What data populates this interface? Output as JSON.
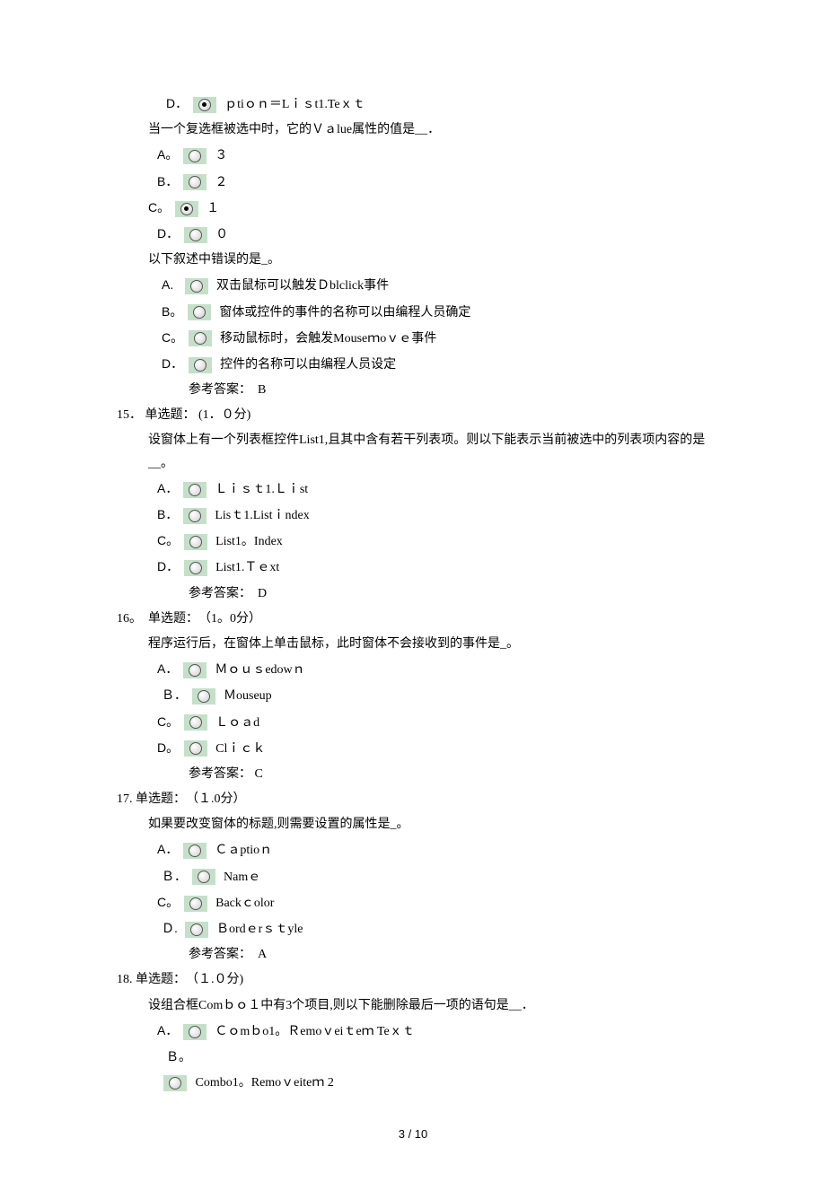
{
  "frag_d_label": "D．",
  "frag_d_text": "ｐtiｏｎ＝Lｉｓt1.Teｘｔ",
  "q13": {
    "stem": "当一个复选框被选中时，它的Ｖａlue属性的值是__．",
    "a_label": "A。",
    "a_text": "３",
    "b_label": "B．",
    "b_text": "２",
    "c_label": "C。",
    "c_text": "１",
    "d_label": "D．",
    "d_text": "０"
  },
  "q14": {
    "stem": "以下叙述中错误的是_。",
    "a_label": "A.",
    "a_text": "双击鼠标可以触发Ｄblclick事件",
    "b_label": "B。",
    "b_text": "窗体或控件的事件的名称可以由编程人员确定",
    "c_label": "C。",
    "c_text": "移动鼠标时，会触发Mouseｍoｖｅ事件",
    "d_label": "D．",
    "d_text": "控件的名称可以由编程人员设定",
    "ans": "参考答案：　B"
  },
  "q15": {
    "num": "15．  单选题：  (1．０分)",
    "stem": "设窗体上有一个列表框控件List1,且其中含有若干列表项。则以下能表示当前被选中的列表项内容的是__。",
    "a_label": "A．",
    "a_text": "Ｌｉｓｔ1.Ｌｉst",
    "b_label": "B．",
    "b_text": "Lisｔ1.Listｉndex",
    "c_label": "C。",
    "c_text": "List1。Index",
    "d_label": "D．",
    "d_text": "List1.Ｔｅxt",
    "ans": "参考答案：　D"
  },
  "q16": {
    "num": "16。　单选题：　（1。0分）",
    "stem": "程序运行后，在窗体上单击鼠标，此时窗体不会接收到的事件是_。",
    "a_label": "A．",
    "a_text": "Ｍｏｕｓedowｎ",
    "b_label": "Ｂ．",
    "b_text": "Ｍouseup",
    "c_label": "C。",
    "c_text": "Ｌｏａd",
    "d_label": "D。",
    "d_text": "Clｉｃｋ",
    "ans": "参考答案：  C"
  },
  "q17": {
    "num": "17. 单选题：　（１.0分）",
    "stem": "如果要改变窗体的标题,则需要设置的属性是_。",
    "a_label": "A．",
    "a_text": "Ｃａptioｎ",
    "b_label": "Ｂ．",
    "b_text": "Namｅ",
    "c_label": "C。",
    "c_text": "Backｃolor",
    "d_label": "Ｄ.",
    "d_text": "Ｂordｅrｓｔyle",
    "ans": "参考答案：　A"
  },
  "q18": {
    "num": "18. 单选题：　（１.０分)",
    "stem": "设组合框Comｂｏ１中有3个项目,则以下能删除最后一项的语句是__．",
    "a_label": "A．",
    "a_text": "Ｃｏmｂo1。Ｒemoｖeiｔeｍ Teｘｔ",
    "b_label": "Ｂ。",
    "b_text": "Combo1。Remoｖeiteｍ  2"
  },
  "footer": "3 / 10"
}
